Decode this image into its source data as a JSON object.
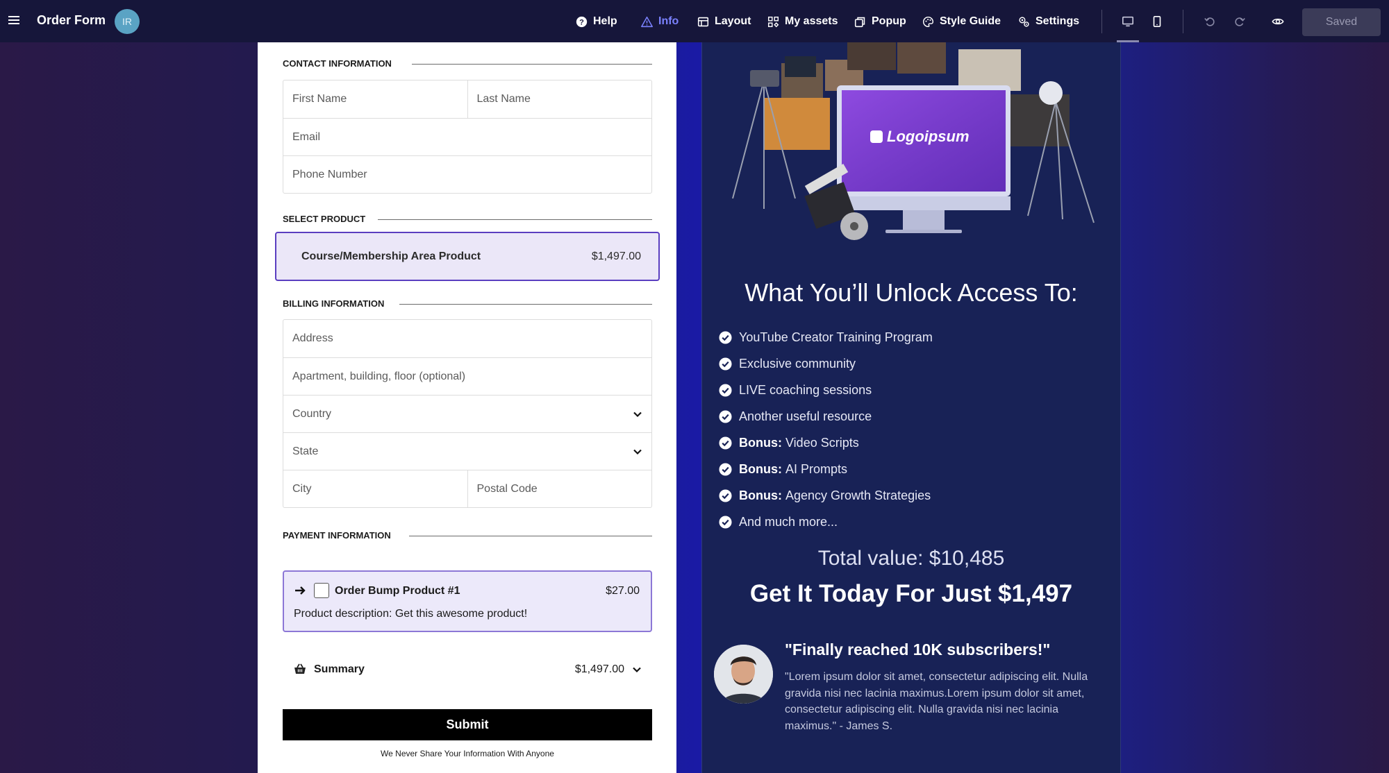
{
  "topbar": {
    "title": "Order Form",
    "avatar_initials": "IR",
    "nav": {
      "help": "Help",
      "info": "Info",
      "layout": "Layout",
      "my_assets": "My assets",
      "popup": "Popup",
      "style_guide": "Style Guide",
      "settings": "Settings"
    },
    "saved_label": "Saved"
  },
  "form": {
    "contact_heading": "CONTACT INFORMATION",
    "first_name_placeholder": "First Name",
    "last_name_placeholder": "Last Name",
    "email_placeholder": "Email",
    "phone_placeholder": "Phone Number",
    "product_heading": "SELECT PRODUCT",
    "product_name": "Course/Membership Area Product",
    "product_price": "$1,497.00",
    "billing_heading": "BILLING INFORMATION",
    "address_placeholder": "Address",
    "apartment_placeholder": "Apartment, building, floor (optional)",
    "country_placeholder": "Country",
    "state_placeholder": "State",
    "city_placeholder": "City",
    "postal_placeholder": "Postal Code",
    "payment_heading": "PAYMENT INFORMATION",
    "bump_title": "Order Bump Product #1",
    "bump_price": "$27.00",
    "bump_desc": "Product description: Get this awesome product!",
    "summary_label": "Summary",
    "summary_amount": "$1,497.00",
    "submit_label": "Submit",
    "privacy_note": "We Never Share Your Information With Anyone"
  },
  "offer": {
    "logo_text": "Logoipsum",
    "heading": "What You’ll Unlock Access To:",
    "benefits": [
      {
        "prefix": "",
        "text": "YouTube Creator Training Program"
      },
      {
        "prefix": "",
        "text": "Exclusive community"
      },
      {
        "prefix": "",
        "text": "LIVE coaching sessions"
      },
      {
        "prefix": "",
        "text": "Another useful resource"
      },
      {
        "prefix": "Bonus:",
        "text": "Video Scripts"
      },
      {
        "prefix": "Bonus:",
        "text": "AI Prompts"
      },
      {
        "prefix": "Bonus:",
        "text": "Agency Growth Strategies"
      },
      {
        "prefix": "",
        "text": "And much more..."
      }
    ],
    "total_value": "Total value: $10,485",
    "price_line": "Get It Today For Just $1,497",
    "testimonial_title": "\"Finally reached 10K subscribers!\"",
    "testimonial_body": "\"Lorem ipsum dolor sit amet, consectetur adipiscing elit. Nulla gravida nisi nec lacinia maximus.Lorem ipsum dolor sit amet, consectetur adipiscing elit. Nulla gravida nisi nec lacinia maximus.\" - James S."
  },
  "colors": {
    "topbar_bg": "#16163a",
    "accent_active": "#7b82ff",
    "product_border": "#5a3ec0",
    "bump_border": "#8c77d6",
    "panel_bg": "#182256"
  }
}
